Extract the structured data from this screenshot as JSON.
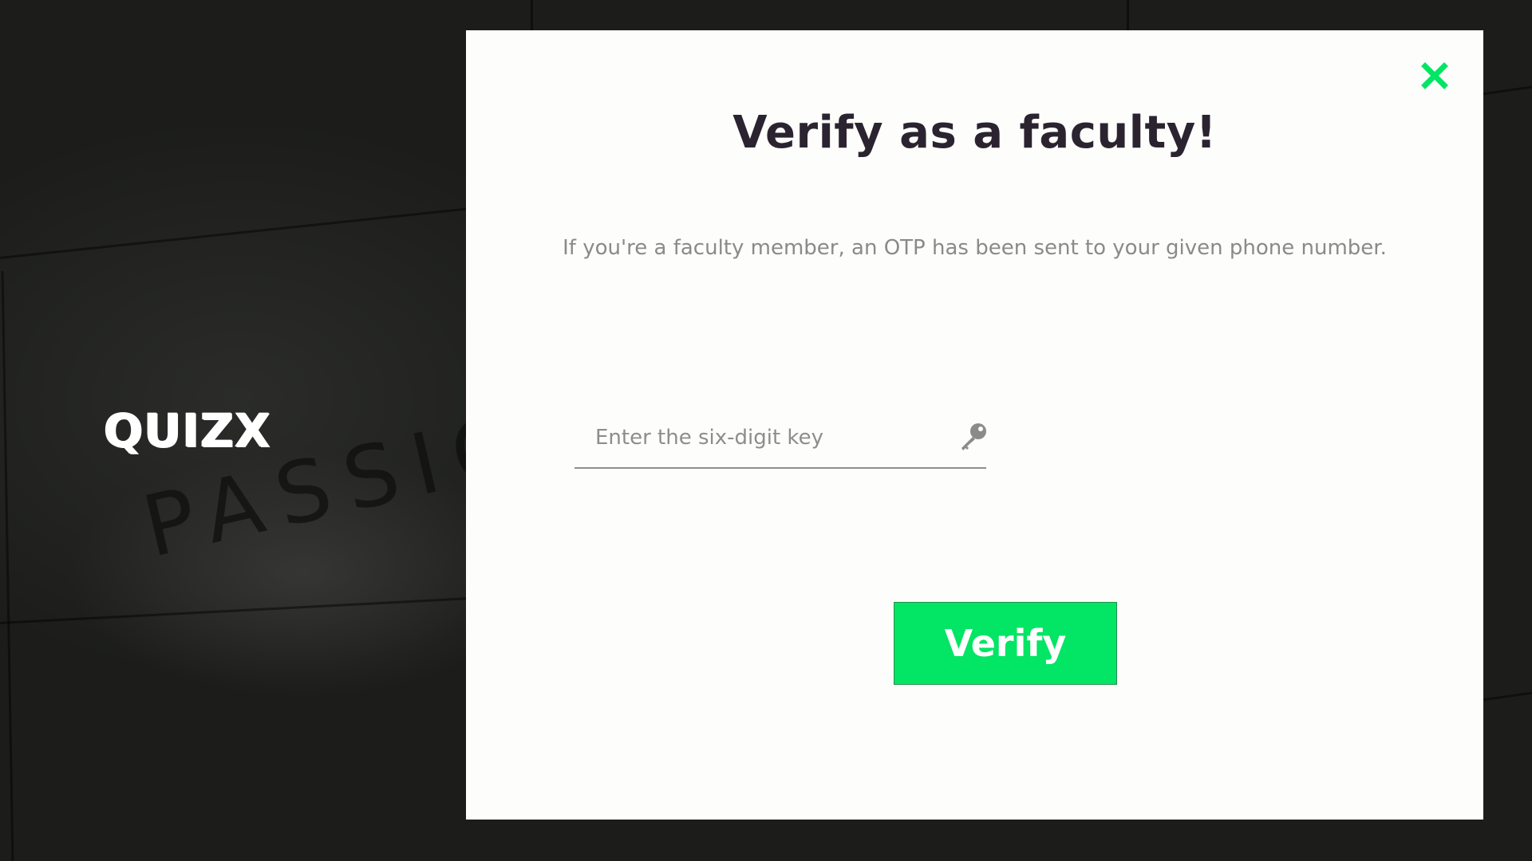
{
  "background": {
    "floor_text": "PASSIO"
  },
  "brand": {
    "logo_text": "QUIZX"
  },
  "modal": {
    "close_icon": "close-icon",
    "title": "Verify as a faculty!",
    "description": "If you're a faculty member, an OTP has been sent to your given phone number.",
    "otp_input": {
      "value": "",
      "placeholder": "Enter the six-digit key",
      "icon": "key-icon"
    },
    "verify_button_label": "Verify"
  },
  "colors": {
    "accent": "#03e564",
    "title": "#2b2430",
    "muted_text": "#8a8a8a",
    "modal_background": "#fdfefb"
  }
}
